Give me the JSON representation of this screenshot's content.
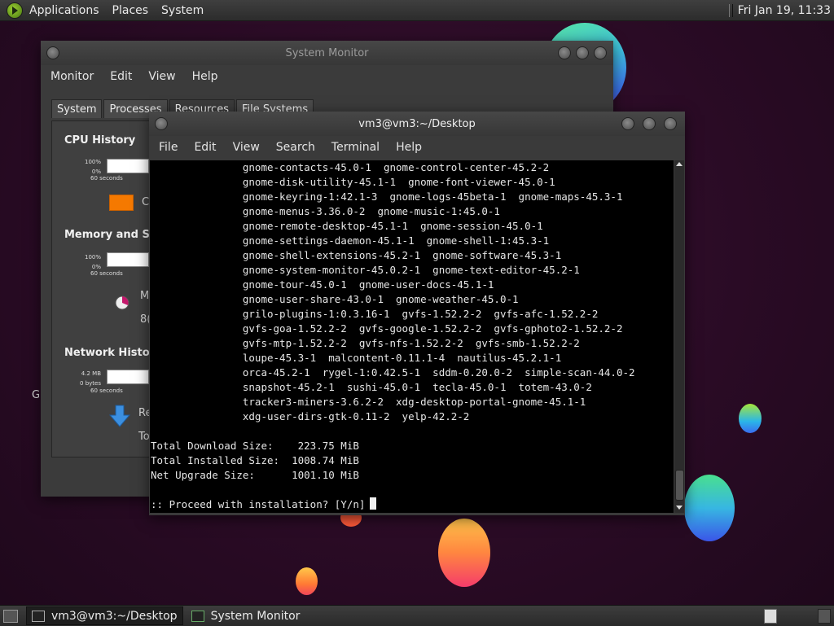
{
  "top_panel": {
    "menu": [
      "Applications",
      "Places",
      "System"
    ],
    "clock": "Fri Jan 19, 11:33"
  },
  "desktop": {
    "partial_label": "G"
  },
  "system_monitor": {
    "title": "System Monitor",
    "menu": [
      "Monitor",
      "Edit",
      "View",
      "Help"
    ],
    "tabs": [
      "System",
      "Processes",
      "Resources",
      "File Systems"
    ],
    "sections": {
      "cpu": {
        "title": "CPU History",
        "scale_top": "100%",
        "scale_bottom": "0%",
        "time_label": "60 seconds",
        "legend_partial": "C",
        "legend_color": "#f57900"
      },
      "memory": {
        "title": "Memory and Swap History",
        "scale_top": "100%",
        "scale_bottom": "0%",
        "time_label": "60 seconds",
        "label_partial_1": "M",
        "label_partial_2": "8("
      },
      "network": {
        "title": "Network History",
        "scale_top": "4.2 MB",
        "scale_bottom": "0 bytes",
        "time_label": "60 seconds",
        "label_partial_1": "Re",
        "label_partial_2": "To"
      }
    }
  },
  "terminal": {
    "title": "vm3@vm3:~/Desktop",
    "menu": [
      "File",
      "Edit",
      "View",
      "Search",
      "Terminal",
      "Help"
    ],
    "lines": [
      "               gnome-contacts-45.0-1  gnome-control-center-45.2-2",
      "               gnome-disk-utility-45.1-1  gnome-font-viewer-45.0-1",
      "               gnome-keyring-1:42.1-3  gnome-logs-45beta-1  gnome-maps-45.3-1",
      "               gnome-menus-3.36.0-2  gnome-music-1:45.0-1",
      "               gnome-remote-desktop-45.1-1  gnome-session-45.0-1",
      "               gnome-settings-daemon-45.1-1  gnome-shell-1:45.3-1",
      "               gnome-shell-extensions-45.2-1  gnome-software-45.3-1",
      "               gnome-system-monitor-45.0.2-1  gnome-text-editor-45.2-1",
      "               gnome-tour-45.0-1  gnome-user-docs-45.1-1",
      "               gnome-user-share-43.0-1  gnome-weather-45.0-1",
      "               grilo-plugins-1:0.3.16-1  gvfs-1.52.2-2  gvfs-afc-1.52.2-2",
      "               gvfs-goa-1.52.2-2  gvfs-google-1.52.2-2  gvfs-gphoto2-1.52.2-2",
      "               gvfs-mtp-1.52.2-2  gvfs-nfs-1.52.2-2  gvfs-smb-1.52.2-2",
      "               loupe-45.3-1  malcontent-0.11.1-4  nautilus-45.2.1-1",
      "               orca-45.2-1  rygel-1:0.42.5-1  sddm-0.20.0-2  simple-scan-44.0-2",
      "               snapshot-45.2-1  sushi-45.0-1  tecla-45.0-1  totem-43.0-2",
      "               tracker3-miners-3.6.2-2  xdg-desktop-portal-gnome-45.1-1",
      "               xdg-user-dirs-gtk-0.11-2  yelp-42.2-2",
      "",
      "Total Download Size:    223.75 MiB",
      "Total Installed Size:  1008.74 MiB",
      "Net Upgrade Size:      1001.10 MiB",
      ""
    ],
    "prompt": ":: Proceed with installation? [Y/n]"
  },
  "bottom_panel": {
    "tasks": [
      "vm3@vm3:~/Desktop",
      "System Monitor"
    ]
  }
}
